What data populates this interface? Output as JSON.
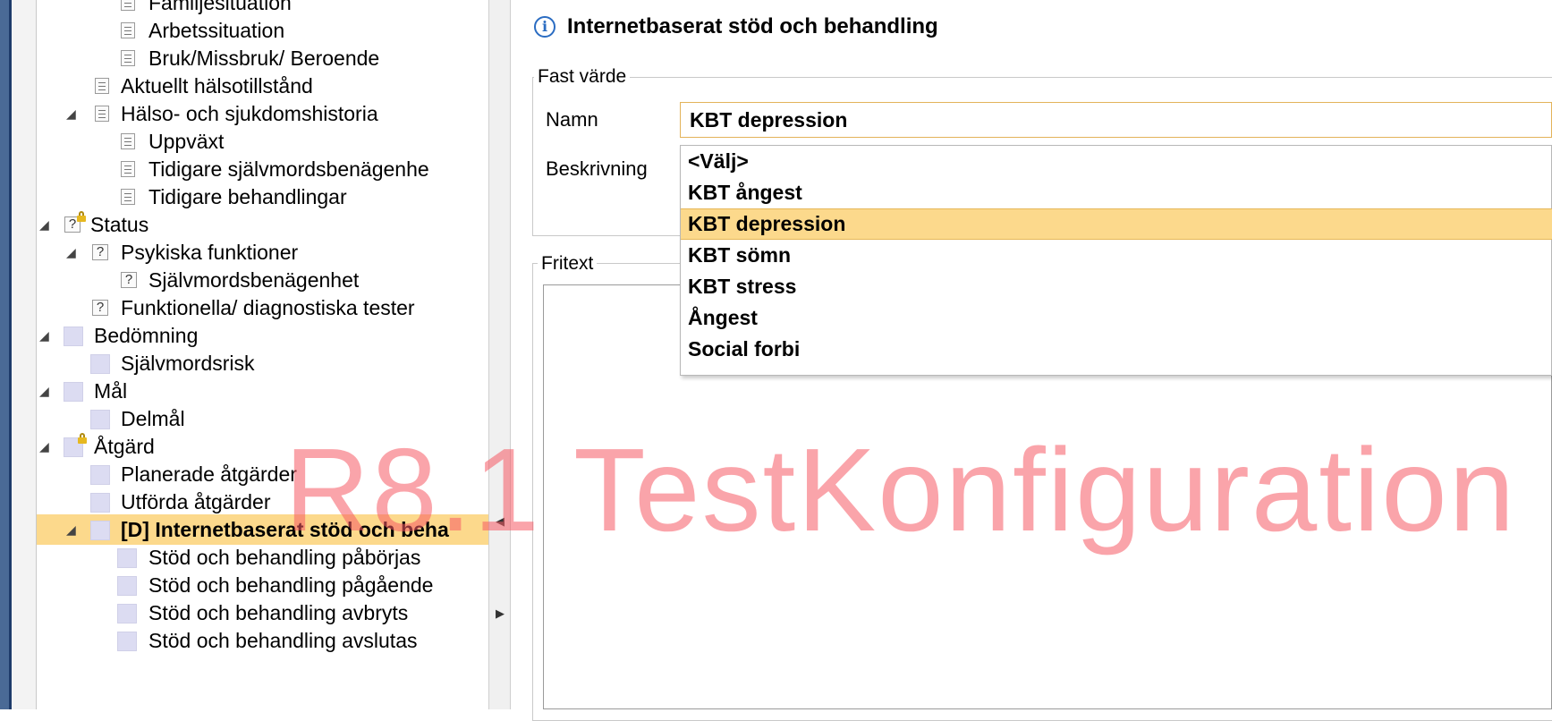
{
  "tree": {
    "items": [
      {
        "label": "Familjesituation"
      },
      {
        "label": "Arbetssituation"
      },
      {
        "label": "Bruk/Missbruk/ Beroende"
      },
      {
        "label": "Aktuellt hälsotillstånd"
      },
      {
        "label": "Hälso- och sjukdomshistoria"
      },
      {
        "label": "Uppväxt"
      },
      {
        "label": "Tidigare självmordsbenägenhe"
      },
      {
        "label": "Tidigare behandlingar"
      },
      {
        "label": "Status"
      },
      {
        "label": "Psykiska funktioner"
      },
      {
        "label": "Självmordsbenägenhet"
      },
      {
        "label": "Funktionella/ diagnostiska tester"
      },
      {
        "label": "Bedömning"
      },
      {
        "label": "Självmordsrisk"
      },
      {
        "label": "Mål"
      },
      {
        "label": "Delmål"
      },
      {
        "label": "Åtgärd"
      },
      {
        "label": "Planerade åtgärder"
      },
      {
        "label": "Utförda åtgärder"
      },
      {
        "label": "[D] Internetbaserat stöd och beha"
      },
      {
        "label": "Stöd och behandling påbörjas"
      },
      {
        "label": "Stöd och behandling pågående"
      },
      {
        "label": "Stöd och behandling avbryts"
      },
      {
        "label": "Stöd och behandling avslutas"
      }
    ]
  },
  "panel": {
    "title": "Internetbaserat stöd och behandling",
    "fast_varde": {
      "legend": "Fast värde",
      "name_label": "Namn",
      "name_value": "KBT depression",
      "description_label": "Beskrivning"
    },
    "fritext": {
      "legend": "Fritext"
    }
  },
  "dropdown": {
    "options": [
      "<Välj>",
      "KBT ångest",
      "KBT depression",
      "KBT sömn",
      "KBT stress",
      "Ångest",
      "Social forbi"
    ],
    "selected": "KBT depression"
  },
  "watermark": "R8.1 TestKonfiguration",
  "colors": {
    "selection": "#fcd98c",
    "watermark": "#f55a64",
    "frame": "#4a6a96",
    "info": "#2a6cc2"
  }
}
